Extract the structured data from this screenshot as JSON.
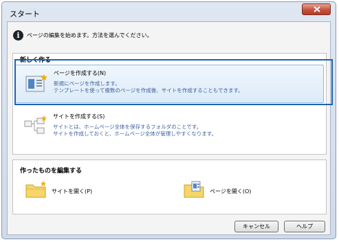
{
  "window": {
    "title": "スタート"
  },
  "info": {
    "message": "ページの編集を始めます。方法を選んでください。"
  },
  "new_section": {
    "title": "新しく作る",
    "create_page": {
      "label": "ページを作成する(N)",
      "desc1": "新規にページを作成します。",
      "desc2": "テンプレートを使って複数のページを作成後、サイトを作成することもできます。"
    },
    "create_site": {
      "label": "サイトを作成する(S)",
      "desc1": "サイトとは、ホームページ全体を保存するフォルダのことです。",
      "desc2": "サイトを作成しておくと、ホームページ全体が管理しやすくなります。"
    }
  },
  "edit_section": {
    "title": "作ったものを編集する",
    "open_site": "サイトを開く(P)",
    "open_page": "ページを開く(O)"
  },
  "buttons": {
    "cancel": "キャンセル",
    "help": "ヘルプ"
  }
}
